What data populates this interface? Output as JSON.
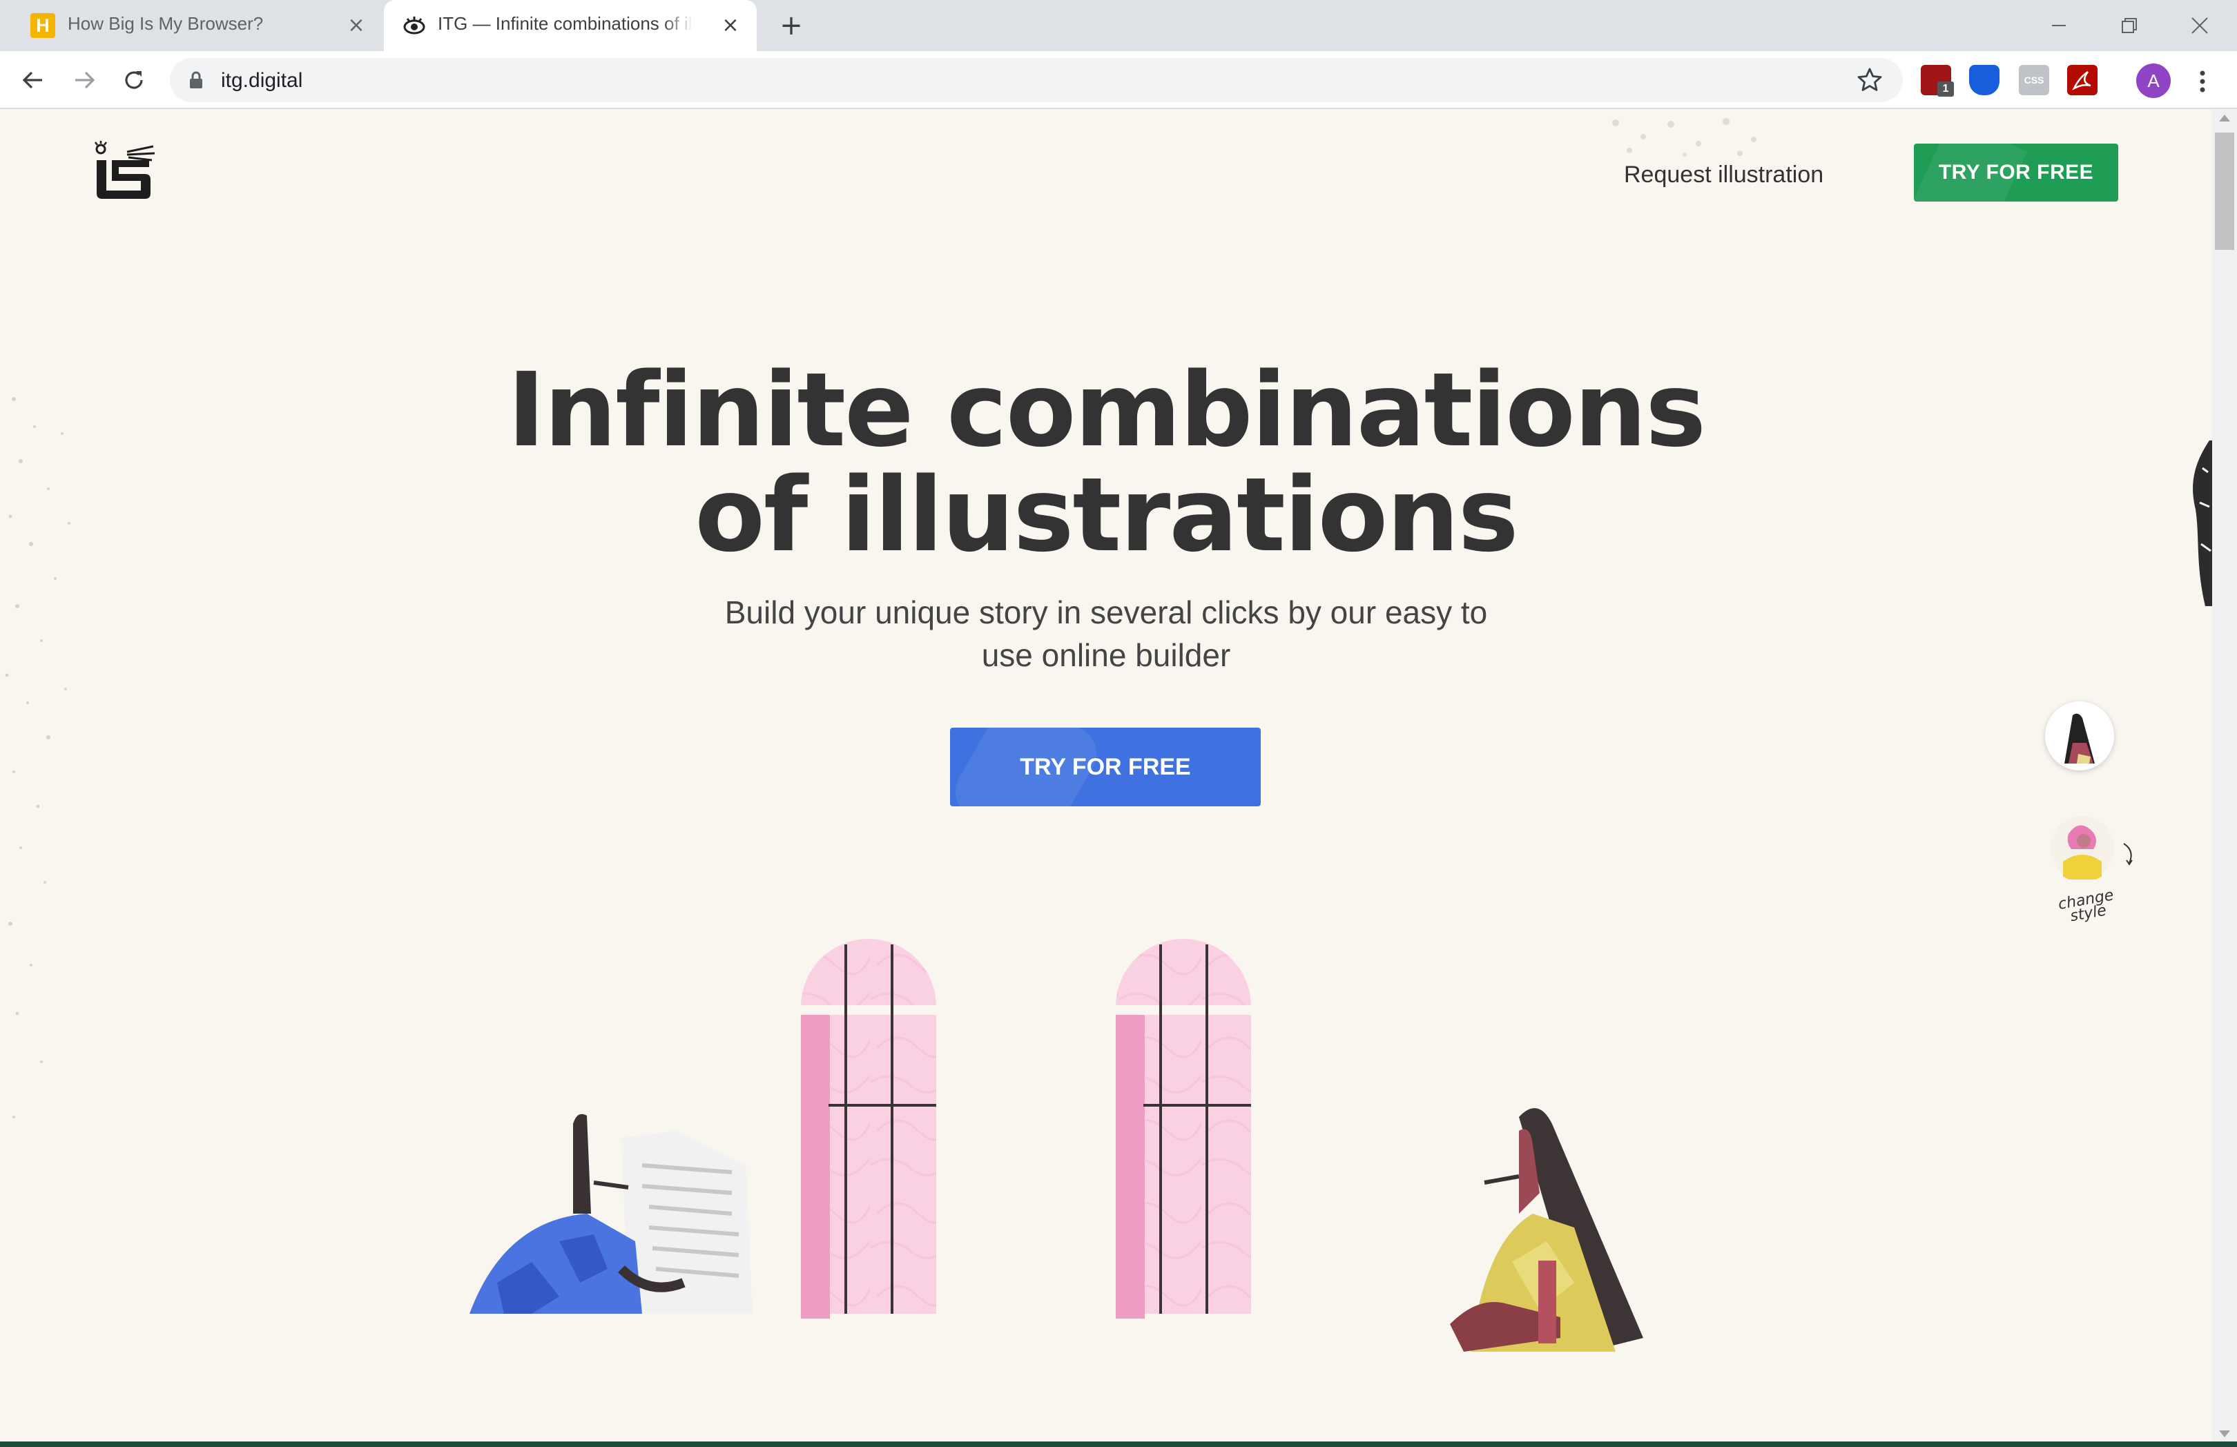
{
  "browser": {
    "tabs": [
      {
        "title": "How Big Is My Browser?",
        "favicon": "H",
        "active": false
      },
      {
        "title": "ITG — Infinite combinations of illustrations",
        "active": true
      }
    ],
    "url": "itg.digital",
    "profile_initial": "A",
    "extension_badge": "1"
  },
  "header": {
    "request_link": "Request illustration",
    "cta_label": "TRY FOR FREE"
  },
  "hero": {
    "title_line1": "Infinite combinations",
    "title_line2": "of illustrations",
    "subtitle_line1": "Build your unique story in several clicks by our easy to",
    "subtitle_line2": "use online builder",
    "cta_label": "TRY FOR FREE"
  },
  "style_switcher": {
    "label_line1": "change",
    "label_line2": "style"
  },
  "colors": {
    "page_bg": "#f9f6f0",
    "header_cta": "#1f9d55",
    "hero_cta": "#3f72e0",
    "title": "#333333",
    "window_pink": "#f9cde0",
    "accent_blue": "#4a74df",
    "accent_yellow": "#dccb5a"
  }
}
